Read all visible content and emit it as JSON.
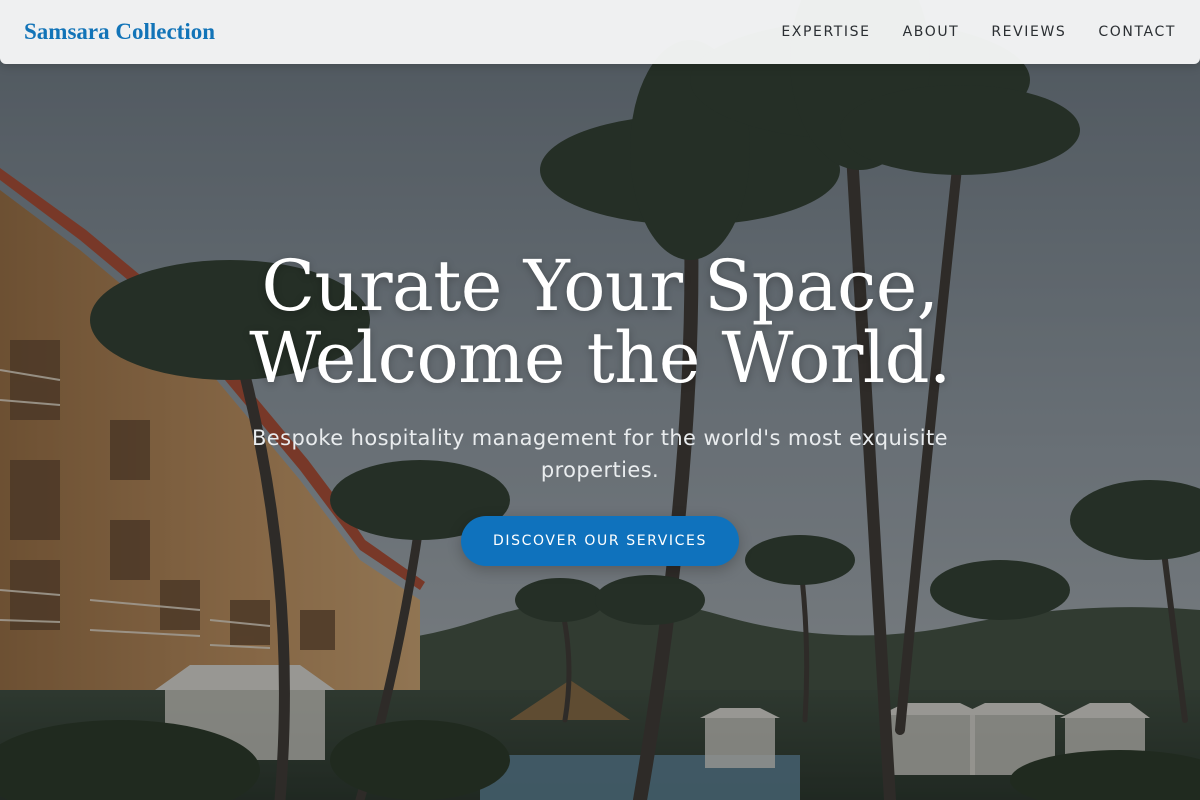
{
  "nav": {
    "brand": "Samsara Collection",
    "links": [
      "EXPERTISE",
      "ABOUT",
      "REVIEWS",
      "CONTACT"
    ]
  },
  "hero": {
    "title_line1": "Curate Your Space,",
    "title_line2": "Welcome the World.",
    "subtitle": "Bespoke hospitality management for the world's most exquisite properties.",
    "cta_label": "DISCOVER OUR SERVICES",
    "background": "resort-with-palm-trees-photo"
  },
  "colors": {
    "brand": "#1274b8",
    "cta": "#0f72bd",
    "nav_bg": "#f6f7f7",
    "text_light": "#ffffff"
  }
}
